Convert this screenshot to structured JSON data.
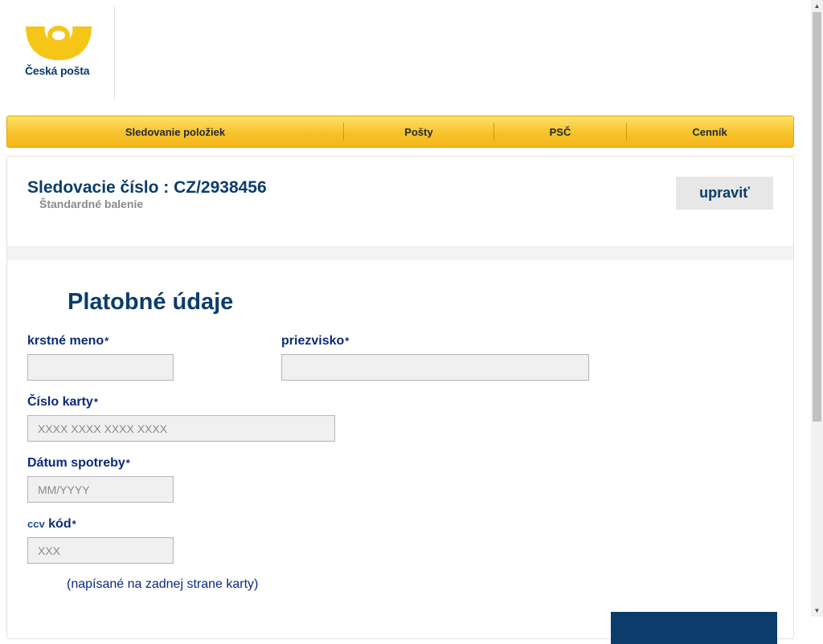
{
  "header": {
    "logo_text": "Česká pošta",
    "brand_color": "#f5c518",
    "primary_color": "#0b3c6b"
  },
  "nav": {
    "items": [
      {
        "label": "Sledovanie položiek"
      },
      {
        "label": "Pošty"
      },
      {
        "label": "PSČ"
      },
      {
        "label": "Cenník"
      }
    ]
  },
  "tracking": {
    "title": "Sledovacie číslo : CZ/2938456",
    "subtitle": "Štandardné balenie",
    "edit_label": "upraviť"
  },
  "payment": {
    "section_title": "Platobné údaje",
    "required_mark": "*",
    "first_name": {
      "label": "krstné meno",
      "value": "",
      "placeholder": ""
    },
    "last_name": {
      "label": "priezvisko",
      "value": "",
      "placeholder": ""
    },
    "card_number": {
      "label": "Číslo karty",
      "value": "",
      "placeholder": "XXXX XXXX XXXX XXXX"
    },
    "expiry": {
      "label": "Dátum spotreby",
      "value": "",
      "placeholder": "MM/YYYY"
    },
    "cvv": {
      "label_small": "ccv",
      "label": "kód",
      "value": "",
      "placeholder": "XXX"
    },
    "cvv_hint": "(napísané na zadnej strane karty)"
  },
  "icons": {
    "logo": "posthorn-logo-icon",
    "scroll_up": "scroll-up-arrow-icon",
    "scroll_down": "scroll-down-arrow-icon"
  }
}
